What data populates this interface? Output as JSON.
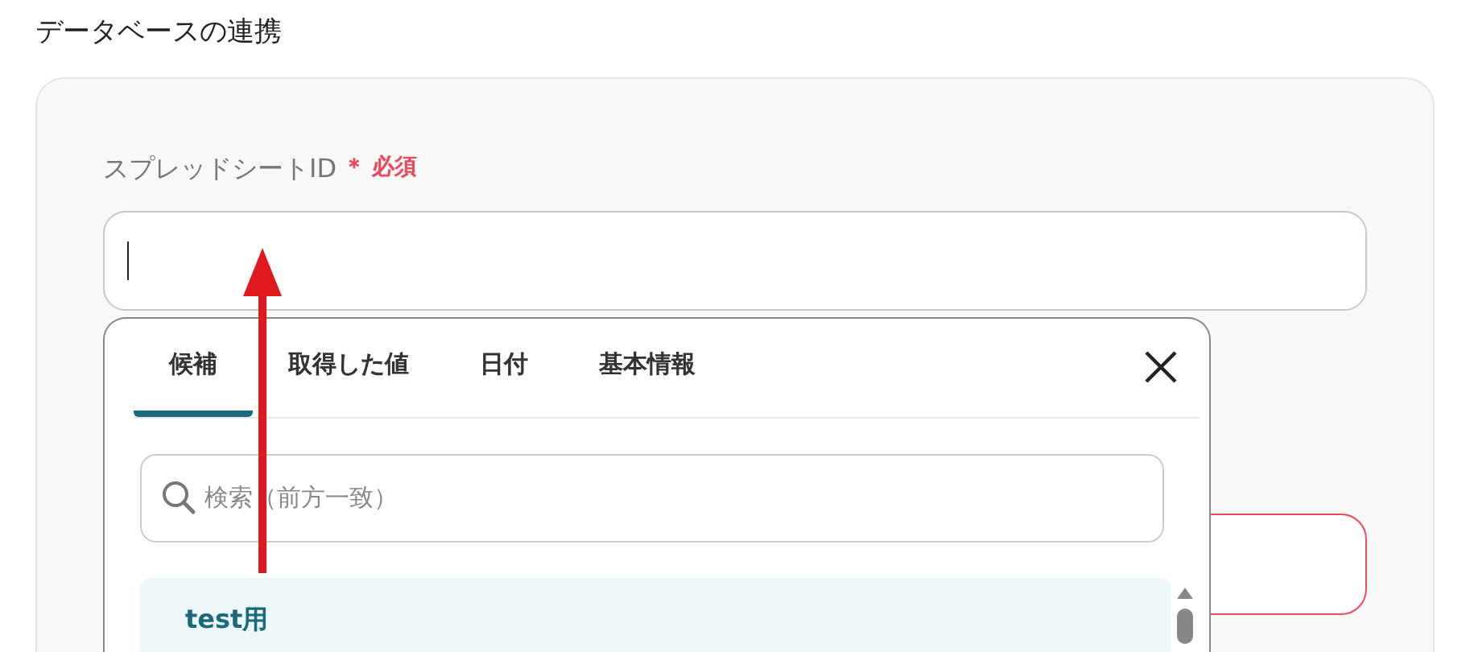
{
  "section_title": "データベースの連携",
  "field": {
    "label": "スプレッドシートID",
    "required_mark": "＊",
    "required_text": "必須",
    "focused": true
  },
  "popup": {
    "tabs": [
      {
        "label": "候補",
        "selected": true
      },
      {
        "label": "取得した値",
        "selected": false
      },
      {
        "label": "日付",
        "selected": false
      },
      {
        "label": "基本情報",
        "selected": false
      }
    ],
    "search": {
      "placeholder": "検索（前方一致）"
    },
    "items": [
      {
        "label": "test用",
        "selected": true
      }
    ]
  },
  "next_field": {
    "invalid": true
  }
}
